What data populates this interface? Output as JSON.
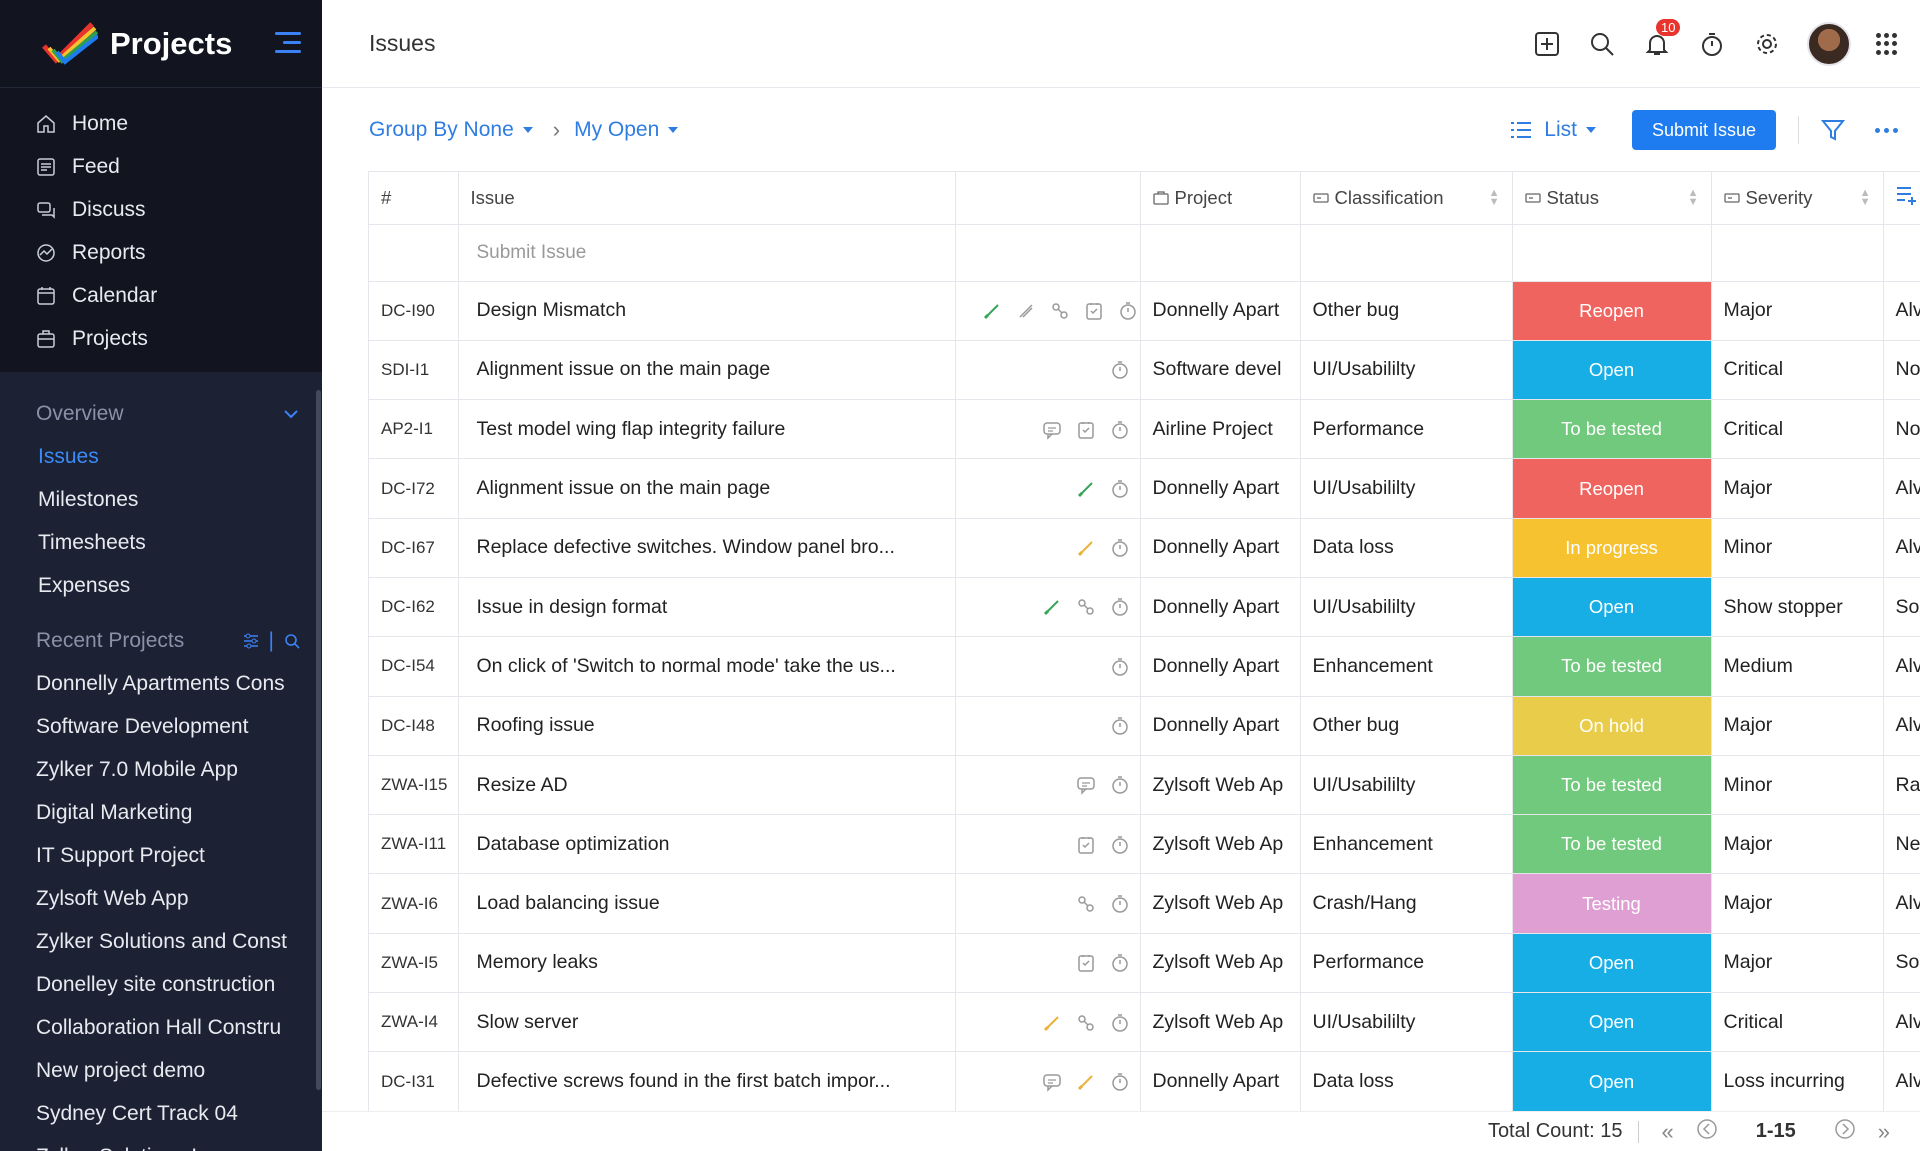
{
  "app": {
    "title": "Projects",
    "page_title": "Issues"
  },
  "nav": [
    {
      "label": "Home",
      "icon": "home-icon"
    },
    {
      "label": "Feed",
      "icon": "feed-icon"
    },
    {
      "label": "Discuss",
      "icon": "discuss-icon"
    },
    {
      "label": "Reports",
      "icon": "reports-icon"
    },
    {
      "label": "Calendar",
      "icon": "calendar-icon"
    },
    {
      "label": "Projects",
      "icon": "projects-icon"
    }
  ],
  "overview": {
    "label": "Overview",
    "items": [
      "Issues",
      "Milestones",
      "Timesheets",
      "Expenses"
    ],
    "active": "Issues"
  },
  "recent": {
    "label": "Recent Projects",
    "items": [
      "Donnelly Apartments Cons",
      "Software Development",
      "Zylker 7.0 Mobile App",
      "Digital Marketing",
      "IT Support Project",
      "Zylsoft Web App",
      "Zylker Solutions and Const",
      "Donelley site construction",
      "Collaboration Hall Constru",
      "New project demo",
      "Sydney Cert Track 04",
      "Zylker Solutions Inc"
    ]
  },
  "topbar": {
    "notification_count": "10"
  },
  "toolbar": {
    "group_by": "Group By None",
    "filter_view": "My Open",
    "view_mode": "List",
    "submit_label": "Submit Issue"
  },
  "table": {
    "columns": [
      "#",
      "Issue",
      "",
      "Project",
      "Classification",
      "Status",
      "Severity"
    ],
    "submit_placeholder": "Submit Issue",
    "rows": [
      {
        "id": "DC-I90",
        "issue": "Design Mismatch",
        "icons": [
          "link-green",
          "link-grey",
          "paperclip",
          "task",
          "timer"
        ],
        "project": "Donnelly Apart",
        "classification": "Other bug",
        "status": "Reopen",
        "status_color": "#f0645f",
        "severity": "Major",
        "extra": "Alv"
      },
      {
        "id": "SDI-I1",
        "issue": "Alignment issue on the main page",
        "icons": [
          "timer"
        ],
        "project": "Software devel",
        "classification": "UI/Usabililty",
        "status": "Open",
        "status_color": "#17aee6",
        "severity": "Critical",
        "extra": "No"
      },
      {
        "id": "AP2-I1",
        "issue": "Test model wing flap integrity failure",
        "icons": [
          "comment",
          "task",
          "timer"
        ],
        "project": "Airline Project",
        "classification": "Performance",
        "status": "To be tested",
        "status_color": "#70c97c",
        "severity": "Critical",
        "extra": "No"
      },
      {
        "id": "DC-I72",
        "issue": "Alignment issue on the main page",
        "icons": [
          "link-green",
          "timer"
        ],
        "project": "Donnelly Apart",
        "classification": "UI/Usabililty",
        "status": "Reopen",
        "status_color": "#f0645f",
        "severity": "Major",
        "extra": "Alv"
      },
      {
        "id": "DC-I67",
        "issue": "Replace defective switches. Window panel bro...",
        "icons": [
          "link-yellow",
          "timer"
        ],
        "project": "Donnelly Apart",
        "classification": "Data loss",
        "status": "In progress",
        "status_color": "#f7c230",
        "severity": "Minor",
        "extra": "Alv"
      },
      {
        "id": "DC-I62",
        "issue": "Issue in design format",
        "icons": [
          "link-green",
          "paperclip",
          "timer"
        ],
        "project": "Donnelly Apart",
        "classification": "UI/Usabililty",
        "status": "Open",
        "status_color": "#17aee6",
        "severity": "Show stopper",
        "extra": "So"
      },
      {
        "id": "DC-I54",
        "issue": "On click of 'Switch to normal mode' take the us...",
        "icons": [
          "timer"
        ],
        "project": "Donnelly Apart",
        "classification": "Enhancement",
        "status": "To be tested",
        "status_color": "#70c97c",
        "severity": "Medium",
        "extra": "Alv"
      },
      {
        "id": "DC-I48",
        "issue": "Roofing issue",
        "icons": [
          "timer"
        ],
        "project": "Donnelly Apart",
        "classification": "Other bug",
        "status": "On hold",
        "status_color": "#e8cc4a",
        "severity": "Major",
        "extra": "Alv"
      },
      {
        "id": "ZWA-I15",
        "issue": "Resize AD",
        "icons": [
          "comment",
          "timer"
        ],
        "project": "Zylsoft Web Ap",
        "classification": "UI/Usabililty",
        "status": "To be tested",
        "status_color": "#70c97c",
        "severity": "Minor",
        "extra": "Ra"
      },
      {
        "id": "ZWA-I11",
        "issue": "Database optimization",
        "icons": [
          "task",
          "timer"
        ],
        "project": "Zylsoft Web Ap",
        "classification": "Enhancement",
        "status": "To be tested",
        "status_color": "#70c97c",
        "severity": "Major",
        "extra": "Ne"
      },
      {
        "id": "ZWA-I6",
        "issue": "Load balancing issue",
        "icons": [
          "paperclip",
          "timer"
        ],
        "project": "Zylsoft Web Ap",
        "classification": "Crash/Hang",
        "status": "Testing",
        "status_color": "#df9fd2",
        "severity": "Major",
        "extra": "Alv"
      },
      {
        "id": "ZWA-I5",
        "issue": "Memory leaks",
        "icons": [
          "task",
          "timer"
        ],
        "project": "Zylsoft Web Ap",
        "classification": "Performance",
        "status": "Open",
        "status_color": "#17aee6",
        "severity": "Major",
        "extra": "So"
      },
      {
        "id": "ZWA-I4",
        "issue": "Slow server",
        "icons": [
          "link-yellow",
          "paperclip",
          "timer"
        ],
        "project": "Zylsoft Web Ap",
        "classification": "UI/Usabililty",
        "status": "Open",
        "status_color": "#17aee6",
        "severity": "Critical",
        "extra": "Alv"
      },
      {
        "id": "DC-I31",
        "issue": "Defective screws found in the first batch impor...",
        "icons": [
          "comment",
          "link-yellow",
          "timer"
        ],
        "project": "Donnelly Apart",
        "classification": "Data loss",
        "status": "Open",
        "status_color": "#17aee6",
        "severity": "Loss incurring",
        "extra": "Alv"
      }
    ]
  },
  "footer": {
    "total_label": "Total Count: 15",
    "range": "1-15"
  }
}
